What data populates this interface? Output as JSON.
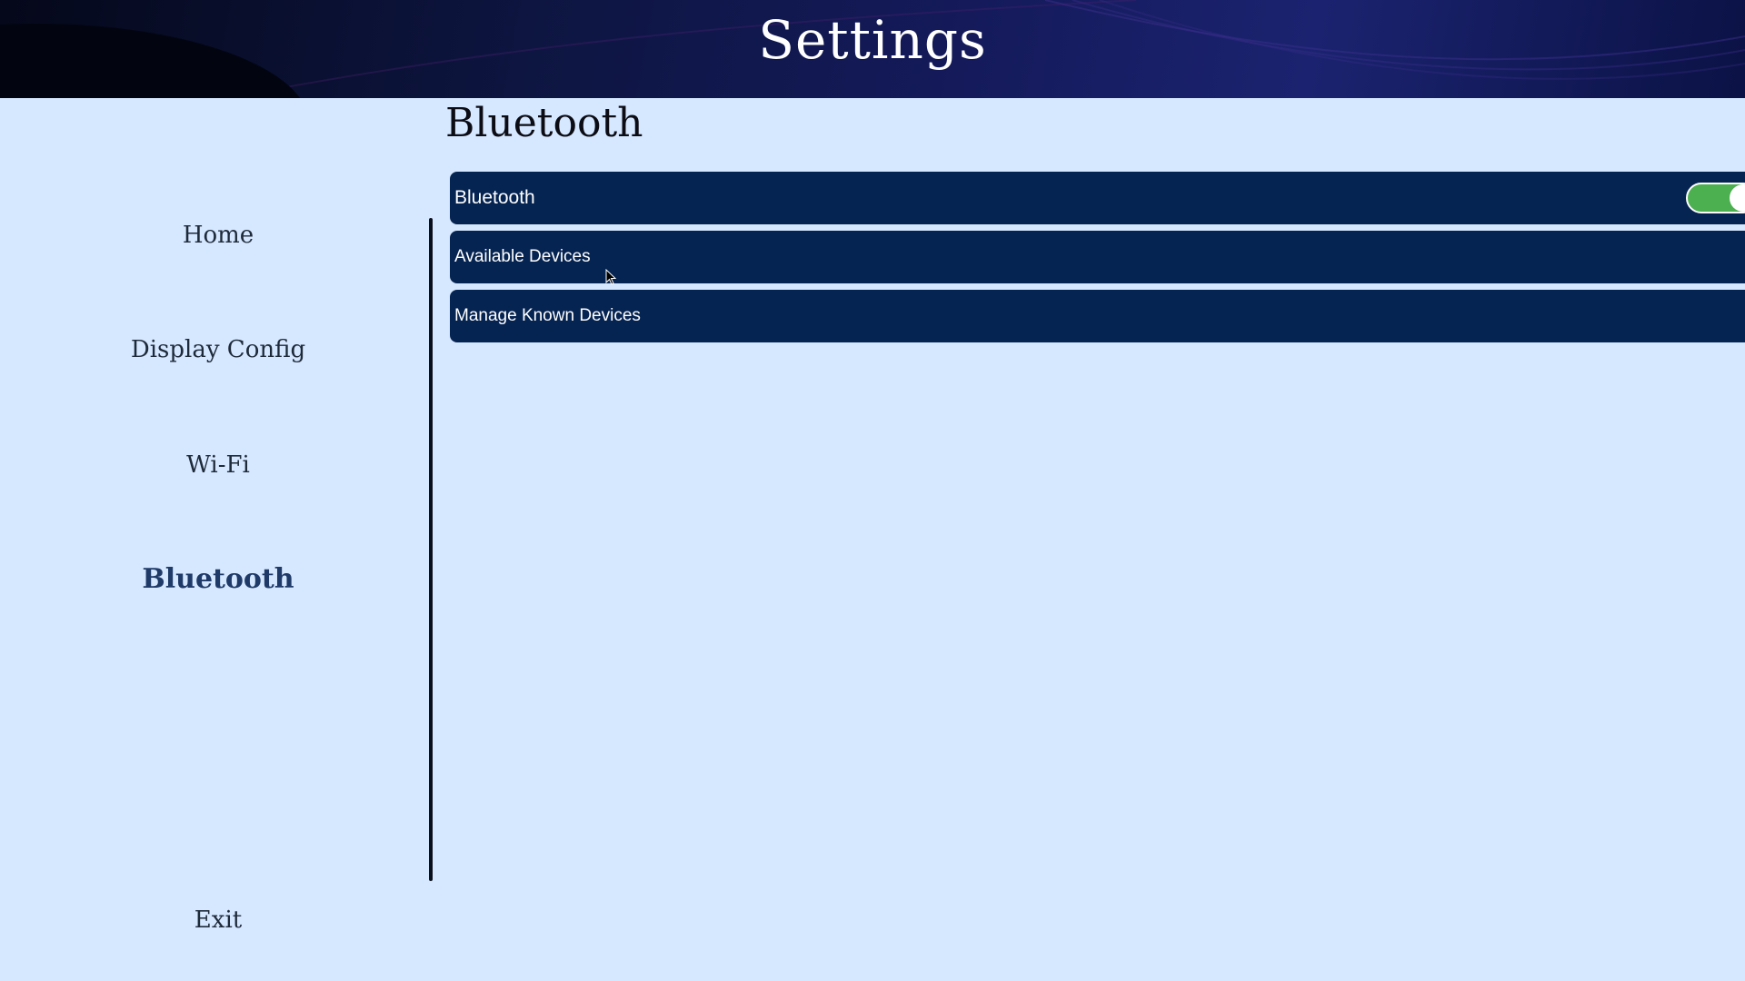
{
  "header": {
    "title": "Settings"
  },
  "sidebar": {
    "items": [
      {
        "label": "Home"
      },
      {
        "label": "Display Config"
      },
      {
        "label": "Wi-Fi"
      },
      {
        "label": "Bluetooth",
        "active": true
      }
    ],
    "exit_label": "Exit"
  },
  "main": {
    "title": "Bluetooth",
    "rows": [
      {
        "label": "Bluetooth",
        "toggle": true
      },
      {
        "label": "Available Devices"
      },
      {
        "label": "Manage Known Devices"
      }
    ]
  },
  "colors": {
    "background": "#d6e8ff",
    "row": "#062452",
    "toggle_on": "#4caf50",
    "active_nav": "#1f3a68"
  }
}
